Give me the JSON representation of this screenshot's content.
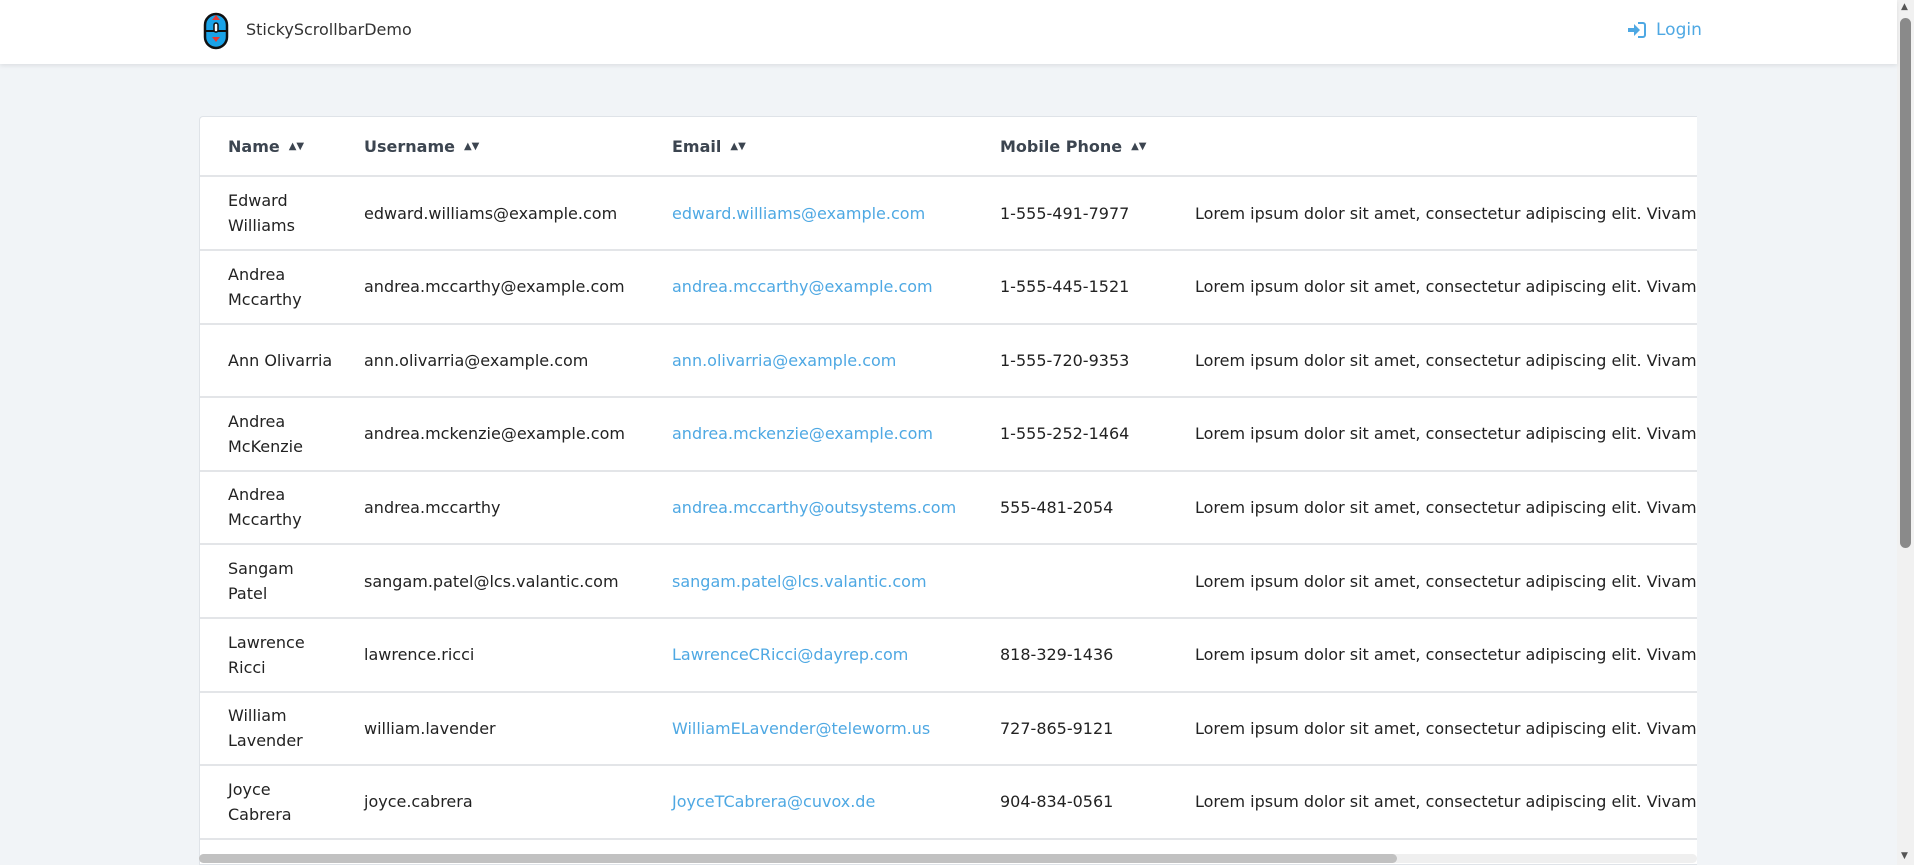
{
  "app": {
    "title": "StickyScrollbarDemo",
    "login_label": "Login"
  },
  "table": {
    "columns": [
      "Name",
      "Username",
      "Email",
      "Mobile Phone",
      ""
    ],
    "rows": [
      {
        "name": "Edward Williams",
        "username": "edward.williams@example.com",
        "email": "edward.williams@example.com",
        "phone": "1-555-491-7977",
        "notes": "Lorem ipsum dolor sit amet, consectetur adipiscing elit. Vivamus g"
      },
      {
        "name": "Andrea Mccarthy",
        "username": "andrea.mccarthy@example.com",
        "email": "andrea.mccarthy@example.com",
        "phone": "1-555-445-1521",
        "notes": "Lorem ipsum dolor sit amet, consectetur adipiscing elit. Vivamus g"
      },
      {
        "name": "Ann Olivarria",
        "username": "ann.olivarria@example.com",
        "email": "ann.olivarria@example.com",
        "phone": "1-555-720-9353",
        "notes": "Lorem ipsum dolor sit amet, consectetur adipiscing elit. Vivamus g"
      },
      {
        "name": "Andrea McKenzie",
        "username": "andrea.mckenzie@example.com",
        "email": "andrea.mckenzie@example.com",
        "phone": "1-555-252-1464",
        "notes": "Lorem ipsum dolor sit amet, consectetur adipiscing elit. Vivamus g"
      },
      {
        "name": "Andrea Mccarthy",
        "username": "andrea.mccarthy",
        "email": "andrea.mccarthy@outsystems.com",
        "phone": "555-481-2054",
        "notes": "Lorem ipsum dolor sit amet, consectetur adipiscing elit. Vivamus g"
      },
      {
        "name": "Sangam Patel",
        "username": "sangam.patel@lcs.valantic.com",
        "email": "sangam.patel@lcs.valantic.com",
        "phone": "",
        "notes": "Lorem ipsum dolor sit amet, consectetur adipiscing elit. Vivamus g"
      },
      {
        "name": "Lawrence Ricci",
        "username": "lawrence.ricci",
        "email": "LawrenceCRicci@dayrep.com",
        "phone": "818-329-1436",
        "notes": "Lorem ipsum dolor sit amet, consectetur adipiscing elit. Vivamus g"
      },
      {
        "name": "William Lavender",
        "username": "william.lavender",
        "email": "WilliamELavender@teleworm.us",
        "phone": "727-865-9121",
        "notes": "Lorem ipsum dolor sit amet, consectetur adipiscing elit. Vivamus g"
      },
      {
        "name": "Joyce Cabrera",
        "username": "joyce.cabrera",
        "email": "JoyceTCabrera@cuvox.de",
        "phone": "904-834-0561",
        "notes": "Lorem ipsum dolor sit amet, consectetur adipiscing elit. Vivamus g"
      }
    ]
  },
  "colors": {
    "accent": "#4ea8e3",
    "background": "#f1f4f7"
  },
  "icons": {
    "logo": "mouse-scroll-logo",
    "login": "sign-in-icon",
    "sort": "sort-icon"
  }
}
